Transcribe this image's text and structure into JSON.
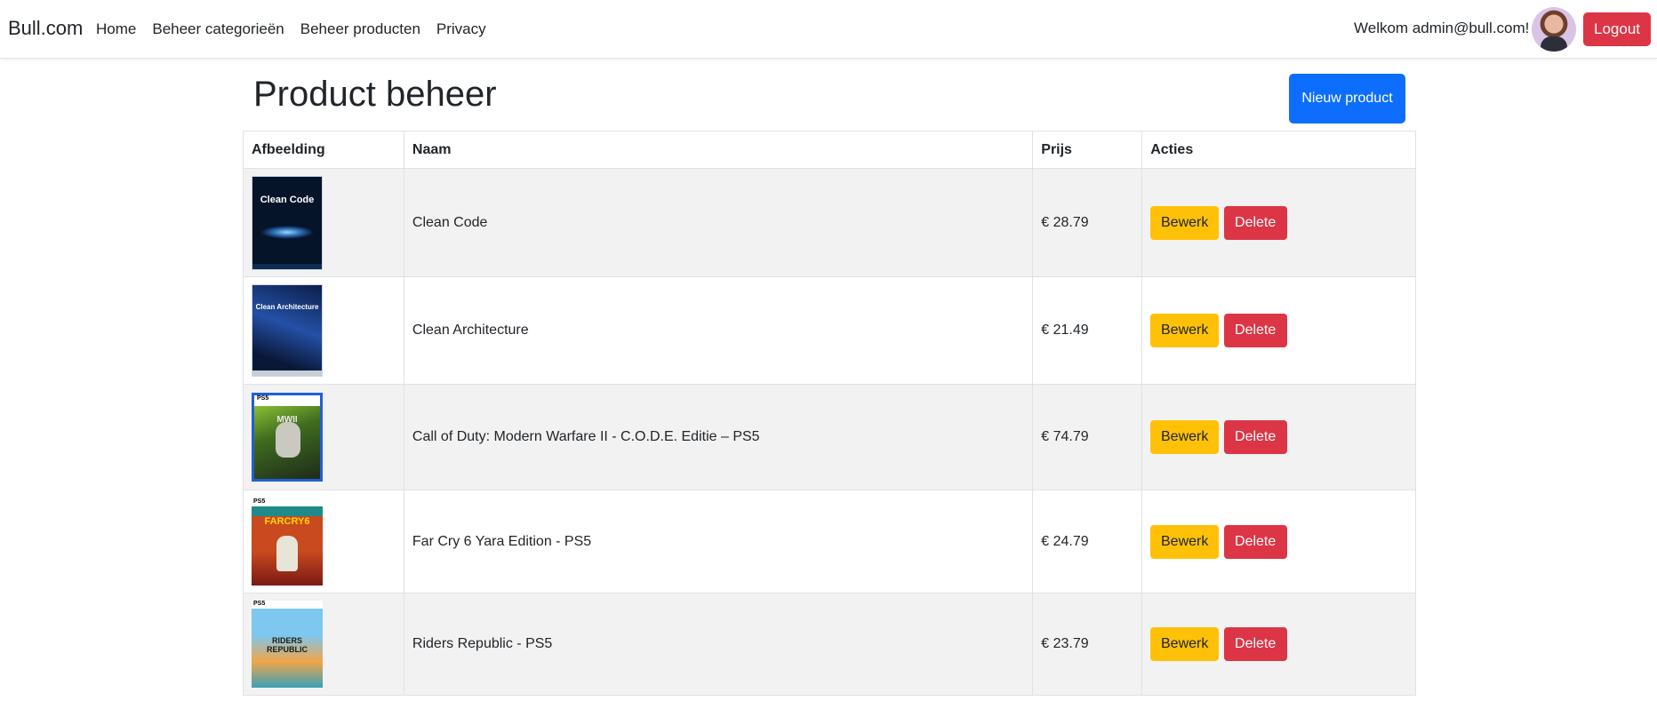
{
  "navbar": {
    "brand": "Bull.com",
    "links": [
      "Home",
      "Beheer categorieën",
      "Beheer producten",
      "Privacy"
    ],
    "welcome": "Welkom admin@bull.com!",
    "logout_label": "Logout"
  },
  "page": {
    "title": "Product beheer",
    "new_button": "Nieuw product"
  },
  "table": {
    "headers": [
      "Afbeelding",
      "Naam",
      "Prijs",
      "Acties"
    ],
    "rows": [
      {
        "name": "Clean Code",
        "price": "€ 28.79",
        "cover_text": "Clean Code"
      },
      {
        "name": "Clean Architecture",
        "price": "€ 21.49",
        "cover_text": "Clean Architecture"
      },
      {
        "name": "Call of Duty: Modern Warfare II - C.O.D.E. Editie – PS5",
        "price": "€ 74.79",
        "cover_text": "MWII"
      },
      {
        "name": "Far Cry 6 Yara Edition - PS5",
        "price": "€ 24.79",
        "cover_text": "FARCRY6"
      },
      {
        "name": "Riders Republic - PS5",
        "price": "€ 23.79",
        "cover_text": "RIDERS REPUBLIC"
      }
    ],
    "edit_label": "Bewerk",
    "delete_label": "Delete"
  },
  "colors": {
    "primary": "#0d6efd",
    "warning": "#ffc107",
    "danger": "#dc3545",
    "stripe": "#f2f2f2"
  }
}
